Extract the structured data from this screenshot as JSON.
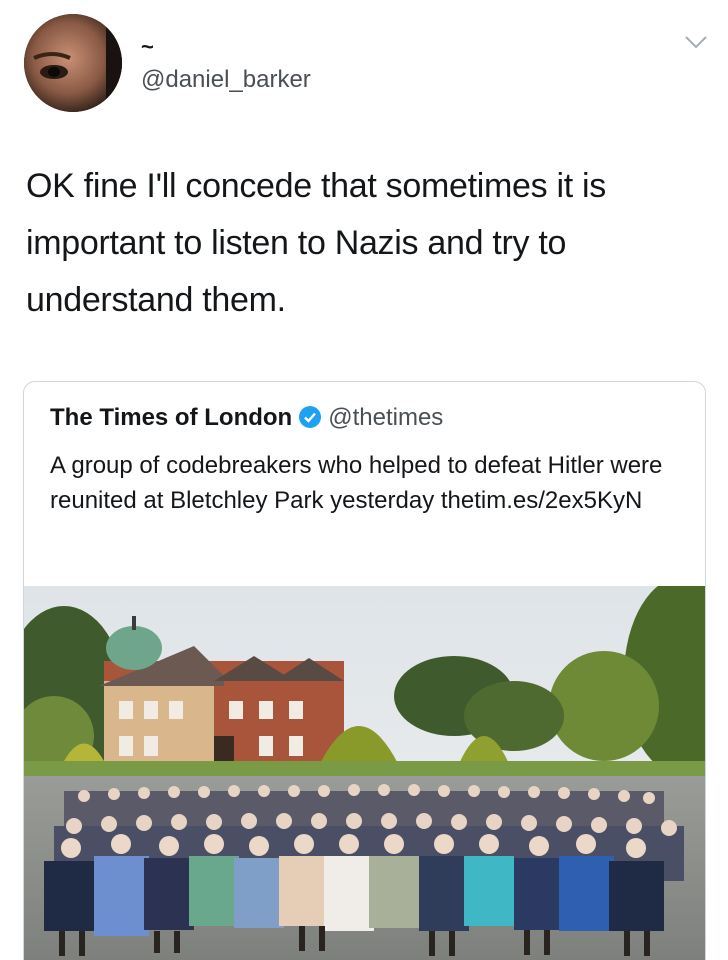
{
  "tweet": {
    "display_name": "~",
    "handle": "@daniel_barker",
    "text": "OK fine I'll concede that sometimes it is important to listen to Nazis and try to understand them."
  },
  "quoted_tweet": {
    "name": "The Times of London",
    "handle": "@thetimes",
    "text": "A group of codebreakers who helped to defeat Hitler were reunited at Bletchley Park yesterday thetim.es/2ex5KyN"
  },
  "colors": {
    "verified": "#1da1f2",
    "text": "#14171a",
    "secondary": "#4a4f54"
  },
  "icons": [
    "chevron-down-icon",
    "verified-badge-icon"
  ]
}
